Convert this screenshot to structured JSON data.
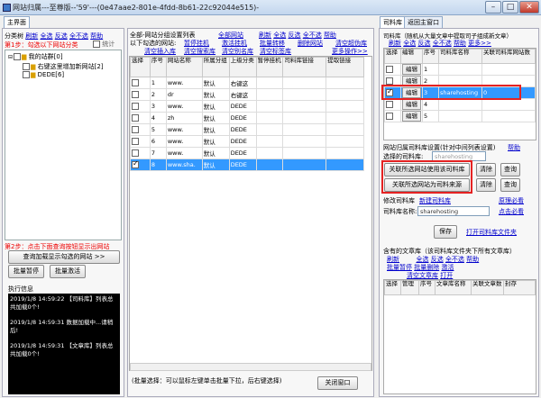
{
  "window": {
    "title": "网站归属---至尊版--'59'---(0e47aae2-801e-4fdd-8b61-22c92044e515)-"
  },
  "left": {
    "tab": "主界面",
    "toolbar": {
      "category_label": "分类树",
      "refresh": "刷新",
      "select_all": "全选",
      "invert": "反选",
      "deselect": "全不选",
      "help": "帮助"
    },
    "step1": "第1步：勾选以下网站分类",
    "stats_label": "统计",
    "tree": {
      "root": "我的站群[0]",
      "child1": "右键这里增加新网站[2]",
      "child2": "DEDE[6]"
    },
    "step2": "第2步：点击下面查询按钮显示出网站",
    "query_button": "查询加载显示勾选的网站 >>",
    "batch_pause": "批量暂停",
    "batch_start": "批量激活",
    "log_title": "执行信息",
    "log_lines": [
      "2019/1/8 14:59:22 【司料库】列表总共加载0个!",
      "2019/1/8 14:59:31 数据加载中...请稍后!",
      "2019/1/8 14:59:31 【文章库】列表总共加载0个!"
    ]
  },
  "middle": {
    "header": "全部-网站分组设置列表",
    "links": {
      "select_all": "全部网站",
      "subtitle": "以下勾选的网站:",
      "pause": "暂停挂机",
      "activate": "激活挂机",
      "batch_move": "批量转移",
      "batch_delete": "删除网站",
      "clear_cache": "清空超伪库",
      "clear_insert": "清空插入库",
      "clear_search": "清空搜索库",
      "clear_cache2": "清空别名库",
      "clear_tag": "清空标签库",
      "refresh": "刷新",
      "sel_all": "全选",
      "invert": "反选",
      "desel": "全不选",
      "help": "帮助",
      "more": "更多操作>>"
    },
    "columns": [
      "选择",
      "序号",
      "网站名称",
      "所属分组",
      "上级分类",
      "暂停挂机",
      "司料库链接",
      "提取链接"
    ],
    "rows": [
      {
        "no": "1",
        "site": "www.",
        "group": "默认",
        "parent": "右键这",
        "checked": false
      },
      {
        "no": "2",
        "site": "dr",
        "group": "默认",
        "parent": "右键这",
        "checked": false
      },
      {
        "no": "3",
        "site": "www.",
        "group": "默认",
        "parent": "DEDE",
        "checked": false
      },
      {
        "no": "4",
        "site": "zh",
        "group": "默认",
        "parent": "DEDE",
        "checked": false
      },
      {
        "no": "5",
        "site": "www.",
        "group": "默认",
        "parent": "DEDE",
        "checked": false
      },
      {
        "no": "6",
        "site": "www.",
        "group": "默认",
        "parent": "DEDE",
        "checked": false
      },
      {
        "no": "7",
        "site": "www.",
        "group": "默认",
        "parent": "DEDE",
        "checked": false
      },
      {
        "no": "8",
        "site": "www.sha.",
        "group": "默认",
        "parent": "DEDE",
        "checked": true
      }
    ],
    "footer_hint": "(批量选择：可以鼠标左键单击批量下拉，后右键选择)",
    "close_button": "关闭窗口"
  },
  "right": {
    "tabs": [
      "司料库",
      "返回主窗口"
    ],
    "lib_title": "司料库（随机从大量文章中提取司子组成新文章）",
    "links": {
      "refresh": "刷新",
      "sel_all": "全选",
      "invert": "反选",
      "desel": "全不选",
      "help": "帮助",
      "more": "更多>>"
    },
    "columns": [
      "选择",
      "编辑",
      "序号",
      "司料库名称",
      "关联司料库网站数"
    ],
    "rows": [
      {
        "edit": "编辑",
        "no": "1",
        "name": "",
        "count": "",
        "checked": false,
        "sel": false
      },
      {
        "edit": "编辑",
        "no": "2",
        "name": "",
        "count": "",
        "checked": false,
        "sel": false
      },
      {
        "edit": "编辑",
        "no": "3",
        "name": "sharehosting",
        "count": "0",
        "checked": true,
        "sel": true
      },
      {
        "edit": "编辑",
        "no": "4",
        "name": "",
        "count": "",
        "checked": false,
        "sel": false
      },
      {
        "edit": "编辑",
        "no": "5",
        "name": "",
        "count": "",
        "checked": false,
        "sel": false
      }
    ],
    "assoc_title": "网站归属司料库设置(针对中间列表设置)",
    "assoc_help": "帮助",
    "selected_label": "选择的司料库:",
    "selected_value": "sharehosting",
    "btn_use": "关联所选网站使用该司料库",
    "btn_use_clear": "清除",
    "btn_use_query": "查询",
    "btn_source": "关联所选网站为司料来源",
    "btn_source_clear": "清除",
    "btn_source_query": "查询",
    "modify_label": "修改司料库",
    "new_label": "新建司料库",
    "sample_label": "原理必看",
    "name_label": "司料库名称:",
    "name_value": "sharehosting",
    "comment_link": "点击必看",
    "save_button": "保存",
    "open_folder": "打开司料库文件夹",
    "article_title": "含有的文章库（该司料库文件夹下所有文章库）",
    "art_links": {
      "refresh": "刷新",
      "sel_all": "全选",
      "invert": "反选",
      "desel": "全不选",
      "help": "帮助",
      "batch_pause": "批量暂停",
      "batch_delete": "批量删除",
      "activate": "激活",
      "clear_lib": "清空文章库",
      "open": "打开"
    },
    "art_columns": [
      "选择",
      "管理",
      "序号",
      "文章库名称",
      "关联文章数",
      "封存"
    ]
  }
}
